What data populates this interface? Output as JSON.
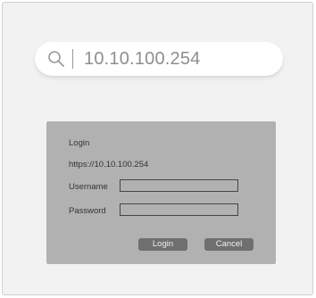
{
  "browser": {
    "address": "10.10.100.254",
    "search_icon": "search-icon"
  },
  "login_dialog": {
    "title": "Login",
    "url": "https://10.10.100.254",
    "username_label": "Username",
    "password_label": "Password",
    "username_value": "",
    "password_value": "",
    "login_button": "Login",
    "cancel_button": "Cancel"
  },
  "colors": {
    "background": "#f2f2f2",
    "dialog": "#b1b1b1",
    "button": "#6f6f6f"
  }
}
